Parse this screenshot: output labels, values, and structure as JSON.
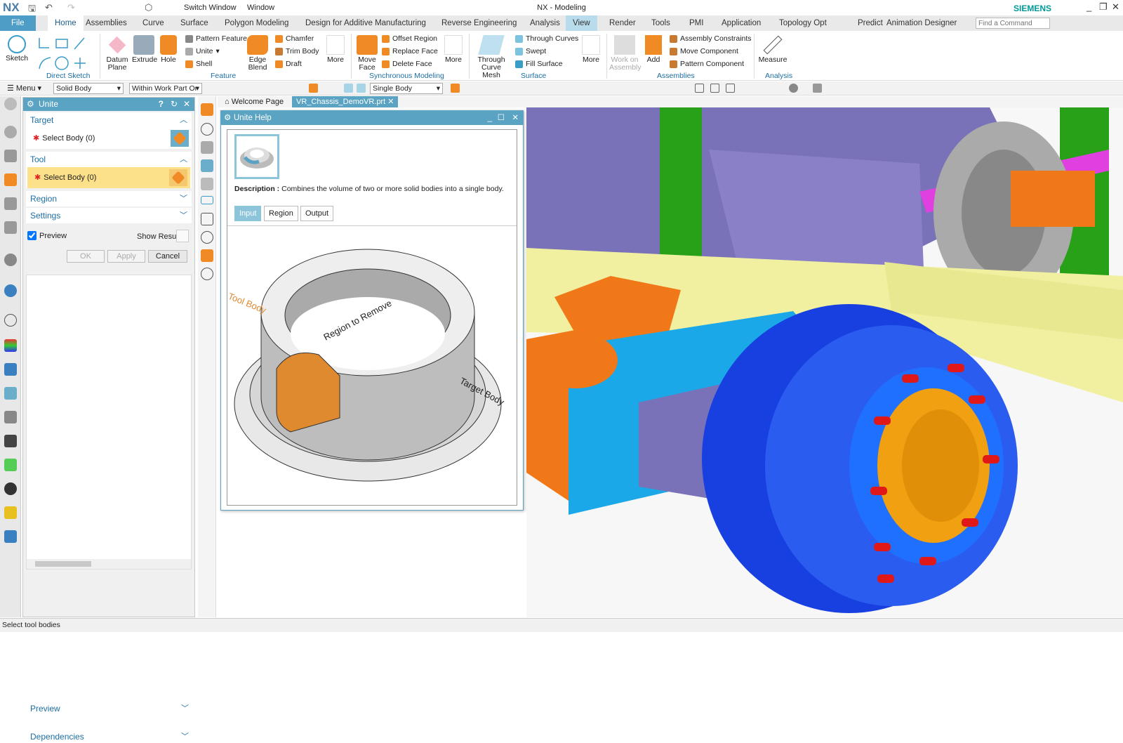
{
  "app": {
    "logo": "NX",
    "title": "NX - Modeling",
    "brand": "SIEMENS"
  },
  "quick_access": {
    "switch_window": "Switch Window",
    "window": "Window"
  },
  "tabs": [
    "File",
    "Home",
    "Assemblies",
    "Curve",
    "Surface",
    "Polygon Modeling",
    "Design for Additive Manufacturing",
    "Reverse Engineering",
    "Analysis",
    "View",
    "Render",
    "Tools",
    "PMI",
    "Application",
    "Topology Opt",
    "Predict",
    "Animation Designer"
  ],
  "active_tab": "Home",
  "find_command": {
    "placeholder": "Find a Command"
  },
  "ribbon": {
    "direct_sketch": {
      "sketch": "Sketch",
      "group": "Direct Sketch"
    },
    "feature": {
      "datum_plane": "Datum Plane",
      "extrude": "Extrude",
      "hole": "Hole",
      "pattern_feature": "Pattern Feature",
      "unite": "Unite",
      "shell": "Shell",
      "edge_blend": "Edge Blend",
      "chamfer": "Chamfer",
      "trim_body": "Trim Body",
      "draft": "Draft",
      "more": "More",
      "group": "Feature"
    },
    "sync": {
      "move_face": "Move Face",
      "offset_region": "Offset Region",
      "replace_face": "Replace Face",
      "delete_face": "Delete Face",
      "more": "More",
      "group": "Synchronous Modeling"
    },
    "surface": {
      "through_curve_mesh": "Through Curve Mesh",
      "through_curves": "Through Curves",
      "swept": "Swept",
      "fill_surface": "Fill Surface",
      "more": "More",
      "group": "Surface"
    },
    "assemblies": {
      "work_on_assembly": "Work on Assembly",
      "add": "Add",
      "assembly_constraints": "Assembly Constraints",
      "move_component": "Move Component",
      "pattern_component": "Pattern Component",
      "group": "Assemblies"
    },
    "analysis": {
      "measure": "Measure",
      "group": "Analysis"
    }
  },
  "selection_bar": {
    "menu": "Menu",
    "type_filter": "Solid Body",
    "scope": "Within Work Part Or",
    "body_rule": "Single Body"
  },
  "dialog": {
    "title": "Unite",
    "target": {
      "label": "Target",
      "select": "Select Body (0)"
    },
    "tool": {
      "label": "Tool",
      "select": "Select Body (0)"
    },
    "region": "Region",
    "settings": "Settings",
    "preview": "Preview",
    "preview_checked": true,
    "show_result": "Show Result",
    "ok": "OK",
    "apply": "Apply",
    "cancel": "Cancel",
    "preview_section": "Preview",
    "dependencies": "Dependencies"
  },
  "doc_tabs": [
    {
      "label": "Welcome Page"
    },
    {
      "label": "VR_Chassis_DemoVR.prt"
    }
  ],
  "help": {
    "title": "Unite Help",
    "description_label": "Description :",
    "description": "Combines the volume of two or more solid bodies into a single body.",
    "tabs": [
      "Input",
      "Region",
      "Output"
    ],
    "active_tab": "Input",
    "labels": {
      "tool_body": "Tool Body",
      "region_to_remove": "Region to Remove",
      "target_body": "Target Body"
    }
  },
  "status": "Select tool bodies",
  "colors": {
    "accent": "#5aa3c3",
    "file_tab": "#4d9dc6",
    "highlight": "#fde08a",
    "brand": "#009999"
  }
}
